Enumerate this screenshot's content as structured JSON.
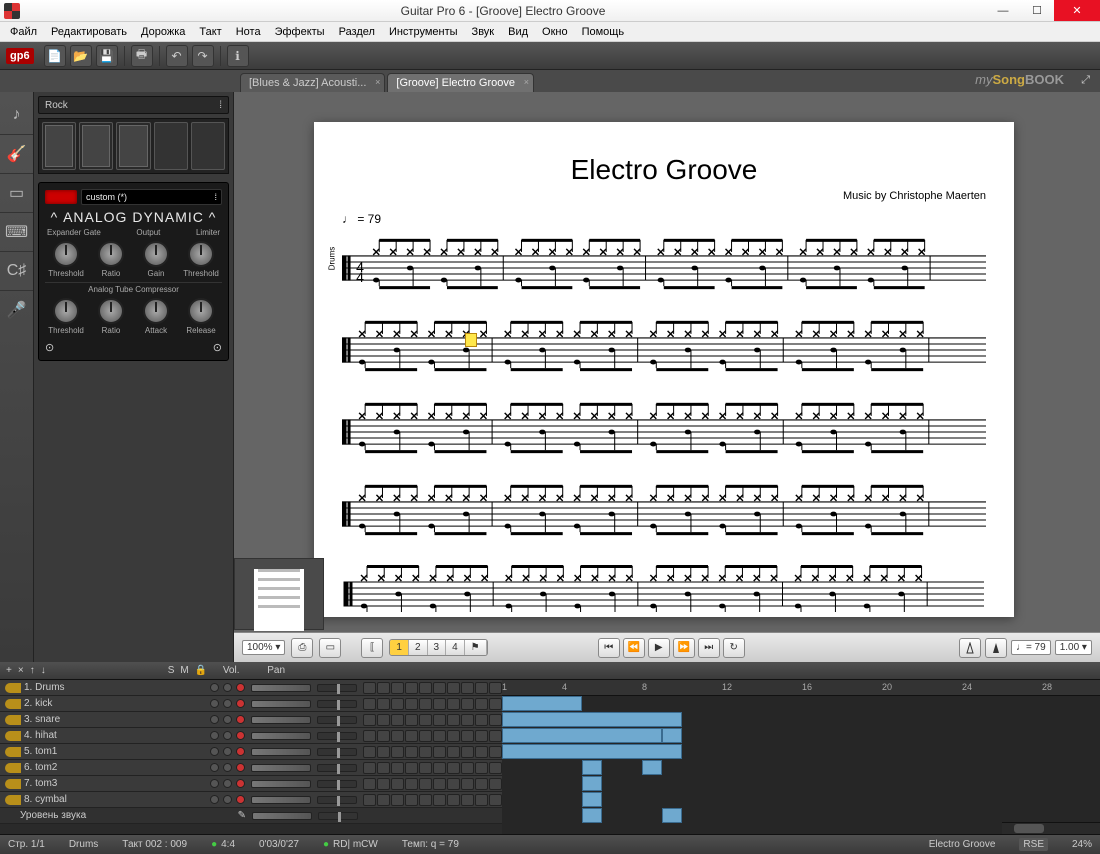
{
  "title": "Guitar Pro 6 - [Groove] Electro Groove",
  "menu": [
    "Файл",
    "Редактировать",
    "Дорожка",
    "Такт",
    "Нота",
    "Эффекты",
    "Раздел",
    "Инструменты",
    "Звук",
    "Вид",
    "Окно",
    "Помощь"
  ],
  "logo": "gp6",
  "tabs": {
    "prev": "[Blues & Jazz] Acousti...",
    "active": "[Groove] Electro Groove"
  },
  "songbook": {
    "prefix": "my",
    "mid": "Song",
    "suffix": "BOOK"
  },
  "sidepanel": {
    "preset": "Rock",
    "custom_label": "custom (*)",
    "fx_title": "ANALOG DYNAMIC",
    "section1_labels": [
      "Expander Gate",
      "Output",
      "Limiter"
    ],
    "row1": [
      "Threshold",
      "Ratio",
      "Gain",
      "Threshold"
    ],
    "compressor_label": "Analog Tube Compressor",
    "row2": [
      "Threshold",
      "Ratio",
      "Attack",
      "Release"
    ]
  },
  "score": {
    "title": "Electro Groove",
    "credit": "Music by Christophe Maerten",
    "tempo_label": "= 79",
    "track_label": "Drums",
    "time_sig": "4/4"
  },
  "transport": {
    "zoom": "100%",
    "sections": [
      "1",
      "2",
      "3",
      "4"
    ],
    "tempo_display": "♩= 79",
    "speed": "1.00"
  },
  "trackhdr": {
    "s": "S",
    "m": "M",
    "vol": "Vol.",
    "pan": "Pan"
  },
  "tracks": [
    {
      "n": "1",
      "name": "Drums"
    },
    {
      "n": "2",
      "name": "kick"
    },
    {
      "n": "3",
      "name": "snare"
    },
    {
      "n": "4",
      "name": "hihat"
    },
    {
      "n": "5",
      "name": "tom1"
    },
    {
      "n": "6",
      "name": "tom2"
    },
    {
      "n": "7",
      "name": "tom3"
    },
    {
      "n": "8",
      "name": "cymbal"
    }
  ],
  "level_row": "Уровень звука",
  "timeline_marks": [
    "1",
    "4",
    "8",
    "12",
    "16",
    "20",
    "24",
    "28"
  ],
  "status": {
    "page": "Стр. 1/1",
    "track": "Drums",
    "bar": "Такт 002 : 009",
    "beat": "4:4",
    "time": "0'03/0'27",
    "rd": "RD| mCW",
    "tempo": "Темп: q = 79",
    "song": "Electro Groove",
    "rse": "RSE",
    "mix": "24%"
  }
}
